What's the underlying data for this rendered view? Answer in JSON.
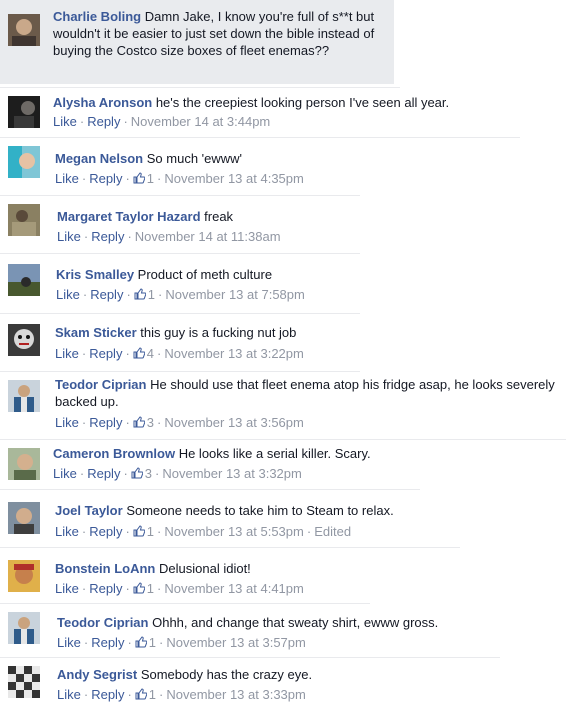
{
  "actions": {
    "like": "Like",
    "reply": "Reply",
    "dot": "·"
  },
  "comments": [
    {
      "author": "Charlie Boling",
      "text": "Damn Jake, I know you're full of s**t but wouldn't it be easier to just set down the bible instead of buying the Costco size boxes of fleet enemas??",
      "likes": "",
      "time": "",
      "edited": ""
    },
    {
      "author": "Alysha Aronson",
      "text": "he's the creepiest looking person I've seen all year.",
      "likes": "",
      "time": "November 14 at 3:44pm",
      "edited": ""
    },
    {
      "author": "Megan Nelson",
      "text": "So much 'ewww'",
      "likes": "1",
      "time": "November 13 at 4:35pm",
      "edited": ""
    },
    {
      "author": "Margaret Taylor Hazard",
      "text": "freak",
      "likes": "",
      "time": "November 14 at 11:38am",
      "edited": ""
    },
    {
      "author": "Kris Smalley",
      "text": "Product of meth culture",
      "likes": "1",
      "time": "November 13 at 7:58pm",
      "edited": ""
    },
    {
      "author": "Skam Sticker",
      "text": "this guy is a fucking nut job",
      "likes": "4",
      "time": "November 13 at 3:22pm",
      "edited": ""
    },
    {
      "author": "Teodor Ciprian",
      "text": "He should use that fleet enema atop his fridge asap, he looks severely backed up.",
      "likes": "3",
      "time": "November 13 at 3:56pm",
      "edited": ""
    },
    {
      "author": "Cameron Brownlow",
      "text": "He looks like a serial killer. Scary.",
      "likes": "3",
      "time": "November 13 at 3:32pm",
      "edited": ""
    },
    {
      "author": "Joel Taylor",
      "text": "Someone needs to take him to Steam to relax.",
      "likes": "1",
      "time": "November 13 at 5:53pm",
      "edited": "Edited"
    },
    {
      "author": "Bonstein LoAnn",
      "text": "Delusional idiot!",
      "likes": "1",
      "time": "November 13 at 4:41pm",
      "edited": ""
    },
    {
      "author": "Teodor Ciprian",
      "text": "Ohhh, and change that sweaty shirt, ewww gross.",
      "likes": "1",
      "time": "November 13 at 3:57pm",
      "edited": ""
    },
    {
      "author": "Andy Segrist",
      "text": "Somebody has the crazy eye.",
      "likes": "1",
      "time": "November 13 at 3:33pm",
      "edited": ""
    }
  ],
  "colors": {
    "author_link": "#3b5998",
    "meta_gray": "#9197a3",
    "bubble_bg": "#f6f7f9"
  }
}
